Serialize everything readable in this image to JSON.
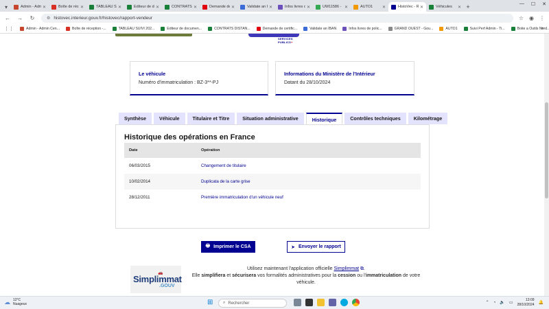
{
  "browser": {
    "tabs": [
      {
        "label": "Admin - Admin",
        "color": "#c8452d",
        "active": false
      },
      {
        "label": "Boîte de réception",
        "color": "#d93025",
        "active": false
      },
      {
        "label": "TABLEAU SUIVI",
        "color": "#188038",
        "active": false
      },
      {
        "label": "Editeur de documents",
        "color": "#188038",
        "active": false
      },
      {
        "label": "CONTRATS DISTANCE",
        "color": "#188038",
        "active": false
      },
      {
        "label": "Demande de certificat",
        "color": "#e1000f",
        "active": false
      },
      {
        "label": "Validate an IBAN",
        "color": "#3b6bd6",
        "active": false
      },
      {
        "label": "Infos livres de police",
        "color": "#6b4fbb",
        "active": false
      },
      {
        "label": "UW11586 -",
        "color": "#34a853",
        "active": false
      },
      {
        "label": "AUTO1",
        "color": "#f29900",
        "active": false
      },
      {
        "label": "HistoVec - Rapport",
        "color": "#000091",
        "active": true
      },
      {
        "label": "Véhicules",
        "color": "#188038",
        "active": false
      }
    ],
    "url": "histovec.interieur.gouv.fr/histovec/rapport-vendeur",
    "bookmarks": [
      {
        "label": "Admin - Admin Cen...",
        "color": "#c8452d"
      },
      {
        "label": "Boîte de réception -...",
        "color": "#d93025"
      },
      {
        "label": "TABLEAU SUIVI 202...",
        "color": "#188038"
      },
      {
        "label": "Editeur de documen...",
        "color": "#188038"
      },
      {
        "label": "CONTRATS DISTAN...",
        "color": "#188038"
      },
      {
        "label": "Demande de certific...",
        "color": "#e1000f"
      },
      {
        "label": "Validate an IBAN",
        "color": "#3b6bd6"
      },
      {
        "label": "Infos livres de polic...",
        "color": "#6b4fbb"
      },
      {
        "label": "GRAND OUEST - Gou...",
        "color": "#888888"
      },
      {
        "label": "AUTO1",
        "color": "#f29900"
      },
      {
        "label": "Suivi Perf Admin - Ti...",
        "color": "#188038"
      },
      {
        "label": "Boite a Outils Nord...",
        "color": "#188038"
      }
    ]
  },
  "header": {
    "logo_text_1": "SERVICES",
    "logo_text_2": "PUBLICS"
  },
  "cards": {
    "vehicle_title": "Le véhicule",
    "vehicle_text": "Numéro d'immatriculation : BZ-3**-PJ",
    "ministry_title": "Informations du Ministère de l'Intérieur",
    "ministry_text": "Datant du 28/10/2024"
  },
  "tabs": [
    {
      "label": "Synthèse",
      "active": false
    },
    {
      "label": "Véhicule",
      "active": false
    },
    {
      "label": "Titulaire et Titre",
      "active": false
    },
    {
      "label": "Situation administrative",
      "active": false
    },
    {
      "label": "Historique",
      "active": true
    },
    {
      "label": "Contrôles techniques",
      "active": false
    },
    {
      "label": "Kilométrage",
      "active": false
    }
  ],
  "history": {
    "title": "Historique des opérations en France",
    "col_date": "Date",
    "col_operation": "Opération",
    "rows": [
      {
        "date": "06/03/2015",
        "operation": "Changement de titulaire"
      },
      {
        "date": "10/02/2014",
        "operation": "Duplicata de la carte grise"
      },
      {
        "date": "28/12/2011",
        "operation": "Première immatriculation d'un véhicule neuf"
      }
    ]
  },
  "actions": {
    "print_label": "Imprimer le CSA",
    "send_label": "Envoyer le rapport"
  },
  "promo": {
    "logo_word_1": "Simplimmat",
    "logo_word_2": ".GOUV",
    "text_1": "Utilisez maintenant l'application officielle",
    "link": "Simplimmat",
    "text_2": "Elle",
    "b1": "simplifiera",
    "text_3": "et",
    "b2": "sécurisera",
    "text_4": "vos formalités administratives pour la",
    "b3": "cession",
    "text_5": "ou l'",
    "b4": "immatriculation",
    "text_6": "de votre véhicule."
  },
  "taskbar": {
    "temp": "12°C",
    "weather": "Nuageux",
    "search_placeholder": "Rechercher",
    "time": "13:09",
    "date": "28/10/2024"
  }
}
